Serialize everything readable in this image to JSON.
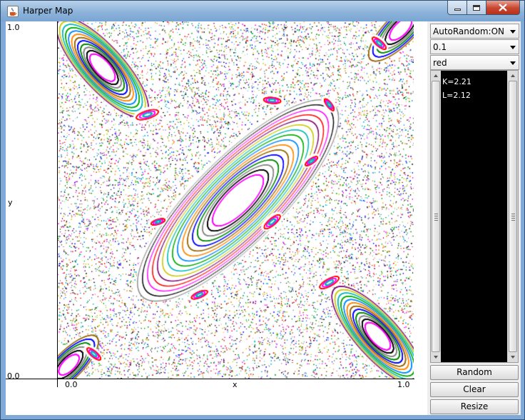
{
  "window": {
    "title": "Harper Map",
    "icon": "java-cup-icon",
    "controls": [
      "minimize-icon",
      "maximize-icon",
      "close-icon"
    ]
  },
  "plot": {
    "x_axis_label": "x",
    "y_axis_label": "y",
    "x_min_label": "0.0",
    "x_max_label": "1.0",
    "y_min_label": "0.0",
    "y_max_label": "1.0",
    "colors": [
      "#ff0000",
      "#00aa00",
      "#0000ff",
      "#ff00ff",
      "#00b8b8",
      "#996600",
      "#000000",
      "#c8c800",
      "#ff8800",
      "#888888",
      "#7a0070",
      "#0088ff",
      "#008800"
    ]
  },
  "controls": {
    "mode_select": "AutoRandom:ON",
    "step_select": "0.1",
    "color_select": "red"
  },
  "info": {
    "lines": [
      "K=2.21",
      "L=2.12"
    ]
  },
  "buttons": {
    "random": "Random",
    "clear": "Clear",
    "resize": "Resize"
  }
}
